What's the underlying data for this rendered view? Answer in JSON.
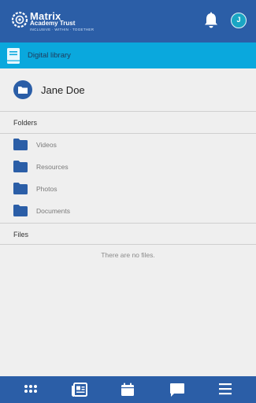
{
  "header": {
    "logo": {
      "title": "Matrix",
      "subtitle": "Academy Trust",
      "tagline": "INCLUSIVE · WITHIN · TOGETHER"
    },
    "user_initial": "J",
    "icons": [
      "bell-icon"
    ]
  },
  "subheader": {
    "title": "Digital library",
    "icon": "book-icon"
  },
  "owner": {
    "name": "Jane Doe",
    "icon": "folder-icon"
  },
  "folders": {
    "heading": "Folders",
    "items": [
      {
        "label": "Videos"
      },
      {
        "label": "Resources"
      },
      {
        "label": "Photos"
      },
      {
        "label": "Documents"
      }
    ]
  },
  "files": {
    "heading": "Files",
    "empty_message": "There are no files."
  },
  "bottom_nav": [
    {
      "icon": "apps-grid-icon"
    },
    {
      "icon": "news-icon"
    },
    {
      "icon": "calendar-icon"
    },
    {
      "icon": "chat-icon"
    },
    {
      "icon": "menu-icon"
    }
  ],
  "colors": {
    "primary": "#2b5ea7",
    "accent": "#0aa8dd",
    "avatar": "#1aa6c4",
    "background": "#efefef"
  }
}
